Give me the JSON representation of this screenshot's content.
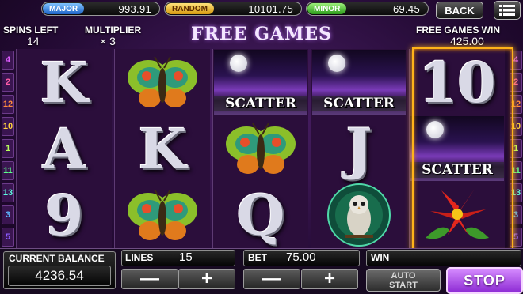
{
  "jackpots": {
    "major": {
      "label": "MAJOR",
      "amount": "993.91"
    },
    "random": {
      "label": "RANDOM",
      "amount": "10101.75"
    },
    "minor": {
      "label": "MINOR",
      "amount": "69.45"
    }
  },
  "header": {
    "back_label": "BACK",
    "menu_icon": "hamburger-menu-icon",
    "spins_left_label": "SPINS LEFT",
    "spins_left_value": "14",
    "multiplier_label": "MULTIPLIER",
    "multiplier_value": "× 3",
    "title": "FREE GAMES",
    "free_games_win_label": "FREE GAMES WIN",
    "free_games_win_value": "425.00"
  },
  "line_numbers_left": [
    "4",
    "2",
    "12",
    "10",
    "1",
    "11",
    "13",
    "3",
    "5"
  ],
  "line_numbers_right": [
    "4",
    "2",
    "12",
    "10",
    "1",
    "11",
    "13",
    "3",
    "5"
  ],
  "line_colors": [
    "#e05cff",
    "#ff5ca8",
    "#ff8a3d",
    "#ffd23d",
    "#b8ff5c",
    "#5cff8a",
    "#5cffe0",
    "#5cb8ff",
    "#8a5cff"
  ],
  "reels": [
    [
      "K",
      "A",
      "9"
    ],
    [
      "moth",
      "K",
      "moth"
    ],
    [
      "SCATTER",
      "moth",
      "Q"
    ],
    [
      "SCATTER",
      "J",
      "owl"
    ],
    [
      "10",
      "SCATTER",
      "flower"
    ]
  ],
  "scatter_label": "SCATTER",
  "bottom": {
    "balance_label": "CURRENT BALANCE",
    "balance_value": "4236.54",
    "lines_label": "LINES",
    "lines_value": "15",
    "bet_label": "BET",
    "bet_value": "75.00",
    "win_label": "WIN",
    "win_value": "",
    "minus": "—",
    "plus": "+",
    "auto_line1": "AUTO",
    "auto_line2": "START",
    "stop_label": "STOP"
  },
  "colors": {
    "highlight": "#ffb319",
    "accent": "#b04be6"
  }
}
